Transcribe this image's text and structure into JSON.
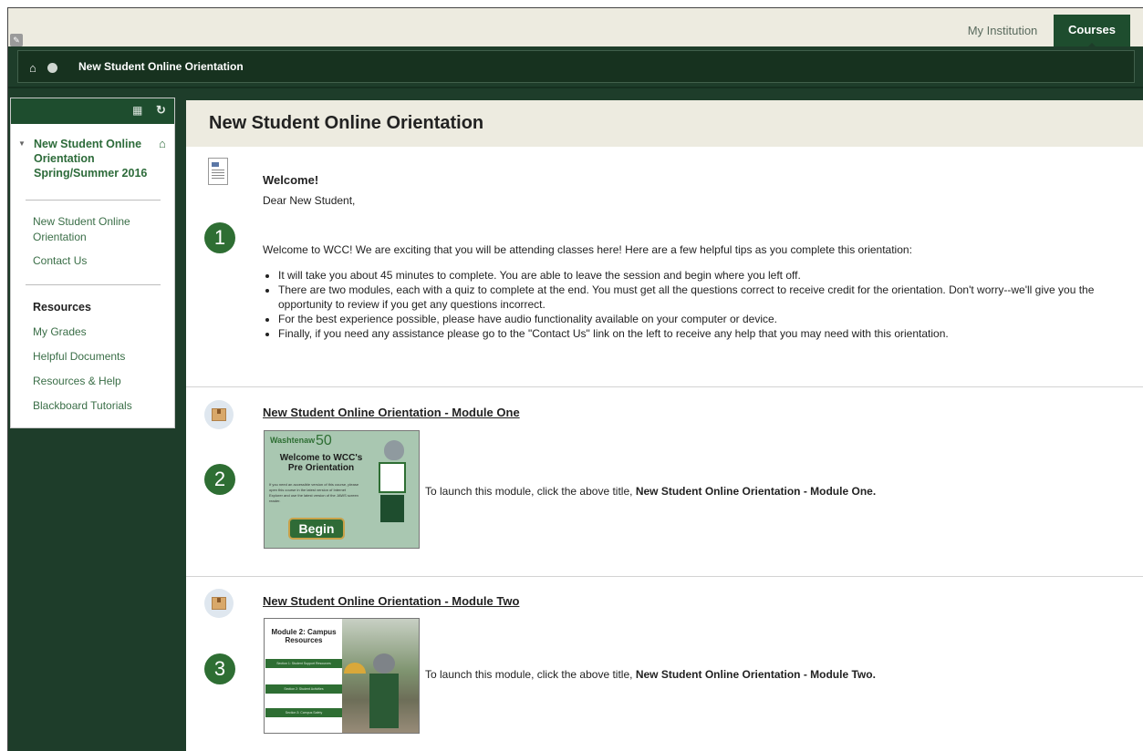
{
  "top_nav": {
    "tabs": [
      {
        "label": "My Institution"
      },
      {
        "label": "Courses"
      }
    ]
  },
  "breadcrumb": {
    "title": "New Student Online Orientation"
  },
  "course_menu": {
    "course_name": "New Student Online Orientation Spring/Summer 2016",
    "links_top": [
      {
        "label": "New Student Online Orientation"
      },
      {
        "label": "Contact Us"
      }
    ],
    "resources_heading": "Resources",
    "links_resources": [
      {
        "label": "My Grades"
      },
      {
        "label": "Helpful Documents"
      },
      {
        "label": "Resources & Help"
      },
      {
        "label": "Blackboard Tutorials"
      }
    ]
  },
  "content": {
    "page_title": "New Student Online Orientation",
    "welcome": {
      "step": "1",
      "title": "Welcome!",
      "greeting": "Dear New Student,",
      "intro": "Welcome to WCC! We are exciting that you will be attending classes here! Here are a few helpful tips as you complete this orientation:",
      "tips": [
        "It will take you about 45 minutes to complete. You are able to leave the session and begin where you left off.",
        "There are two modules, each with a quiz to complete at the end. You must get all the questions correct to receive credit for the orientation. Don't worry--we'll give you the opportunity to review if you get any questions incorrect.",
        "For the best experience possible, please have audio functionality available on your computer or device.",
        "Finally, if you need any assistance please go to the \"Contact Us\" link on the left to receive any help that you may need with this orientation."
      ]
    },
    "module_one": {
      "step": "2",
      "title": "New Student Online Orientation - Module One",
      "launch_prefix": "To launch this module, click the above title,",
      "launch_bold": "New Student Online Orientation - Module One.",
      "thumb": {
        "brand": "Washtenaw",
        "brand_num": "50",
        "welcome": "Welcome to WCC's Pre Orientation",
        "fine_print": "If you need an accessible version of this course, please open this course in the latest version of Internet Explorer and use the latest version of the JAWS screen reader.",
        "button": "Begin"
      }
    },
    "module_two": {
      "step": "3",
      "title": "New Student Online Orientation - Module Two",
      "launch_prefix": "To launch this module, click the above title,",
      "launch_bold": "New Student Online Orientation - Module Two.",
      "thumb": {
        "heading": "Module 2: Campus Resources",
        "sections": [
          "Section 1: Student Support Resources",
          "Section 2: Student Activities",
          "Section 3: Campus Safety"
        ]
      }
    }
  },
  "colors": {
    "brand_dark_green": "#1e3d2a",
    "tab_active": "#1e4d2e",
    "step_badge": "#2e6e33",
    "link_green": "#3a6e47",
    "header_beige": "#edebe0"
  },
  "icons": {
    "home": "home-icon",
    "status_dot": "status-dot-icon",
    "reorder": "folder-view-icon",
    "refresh": "refresh-icon",
    "document": "document-icon",
    "module": "module-package-icon"
  }
}
